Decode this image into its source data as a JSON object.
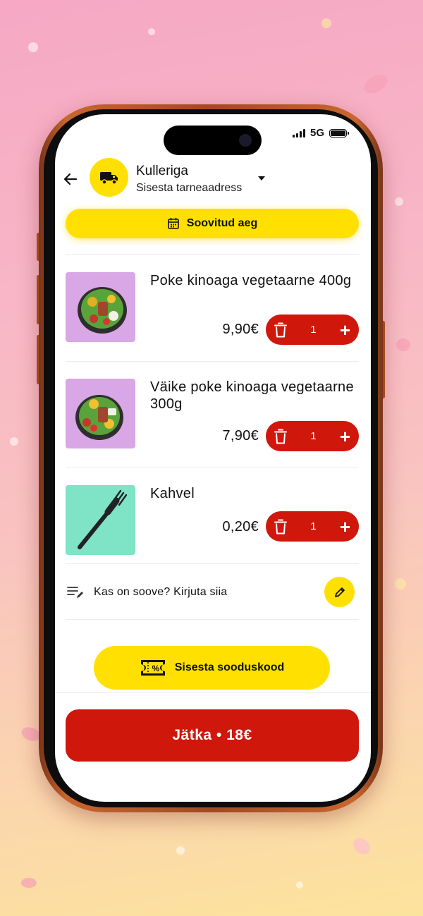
{
  "status": {
    "network": "5G"
  },
  "header": {
    "delivery_title": "Kulleriga",
    "delivery_subtitle": "Sisesta tarneaadress"
  },
  "preferred_time_label": "Soovitud aeg",
  "cart": {
    "items": [
      {
        "name": "Poke kinoaga vegetaarne 400g",
        "price": "9,90€",
        "quantity": "1"
      },
      {
        "name": "Väike poke kinoaga vegetaarne 300g",
        "price": "7,90€",
        "quantity": "1"
      },
      {
        "name": "Kahvel",
        "price": "0,20€",
        "quantity": "1"
      }
    ]
  },
  "notes_placeholder": "Kas on soove? Kirjuta siia",
  "promo_label": "Sisesta sooduskood",
  "continue_label": "Jätka • 18€",
  "colors": {
    "accent_yellow": "#ffe000",
    "accent_red": "#d0170c",
    "phone_frame": "#c8662e"
  },
  "icons": [
    "back-arrow-icon",
    "truck-icon",
    "dropdown-caret-icon",
    "calendar-icon",
    "trash-icon",
    "plus-icon",
    "notes-icon",
    "pencil-icon",
    "discount-ticket-icon"
  ]
}
